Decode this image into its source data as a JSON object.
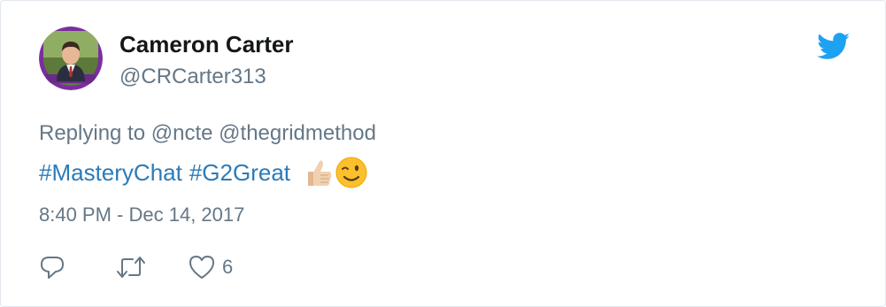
{
  "user": {
    "display_name": "Cameron Carter",
    "screen_name": "@CRCarter313",
    "avatar_icon": "profile-photo"
  },
  "brand": {
    "icon": "twitter-bird-icon",
    "color": "#1da1f2"
  },
  "reply": {
    "prefix": "Replying to",
    "mentions": [
      "@ncte",
      "@thegridmethod"
    ]
  },
  "tweet": {
    "hashtags": [
      "#MasteryChat",
      "#G2Great"
    ],
    "emojis": [
      "thumbs-up-light-skin-tone",
      "winking-face"
    ],
    "timestamp": "8:40 PM - Dec 14, 2017"
  },
  "actions": {
    "reply_icon": "reply-icon",
    "retweet_icon": "retweet-icon",
    "like_icon": "heart-icon",
    "like_count": "6"
  },
  "colors": {
    "link": "#2b7bb9",
    "muted": "#657786",
    "text": "#14171a"
  }
}
